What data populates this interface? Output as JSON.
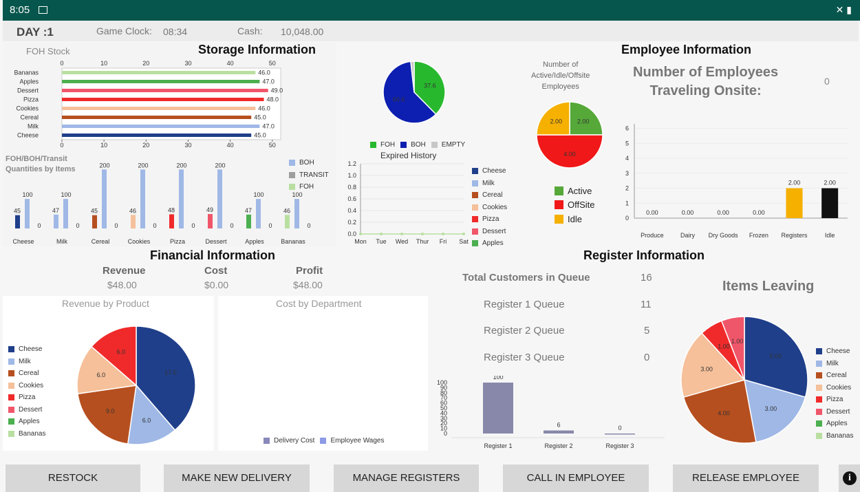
{
  "status": {
    "time": "8:05"
  },
  "header": {
    "day": "DAY :1",
    "game_clock_label": "Game Clock:",
    "game_clock_value": "08:34",
    "cash_label": "Cash:",
    "cash_value": "10,048.00"
  },
  "colors": {
    "status_bar": "#07564d",
    "boh": "#9fb8e6",
    "transit": "#9e9e9e",
    "foh_light": "#b9dfa0"
  },
  "storage": {
    "title": "Storage Information",
    "foh_label": "FOH Stock",
    "qty_label": "FOH/BOH/Transit\nQuantities by Items"
  },
  "expired": {
    "title": "Expired History"
  },
  "employee": {
    "title": "Employee Information",
    "pie_label": "Number of\nActive/Idle/Offsite\nEmployees",
    "traveling_label": "Number of Employees\nTraveling Onsite:",
    "traveling_value": "0"
  },
  "financial": {
    "title": "Financial Information",
    "revenue_label": "Revenue",
    "revenue_value": "$48.00",
    "cost_label": "Cost",
    "cost_value": "$0.00",
    "profit_label": "Profit",
    "profit_value": "$48.00",
    "rev_by_product": "Revenue by Product",
    "cost_by_dept": "Cost by Department"
  },
  "register": {
    "title": "Register Information",
    "total_label": "Total Customers in Queue",
    "total_value": "16",
    "r1_label": "Register 1 Queue",
    "r1_value": "11",
    "r2_label": "Register 2 Queue",
    "r2_value": "5",
    "r3_label": "Register 3 Queue",
    "r3_value": "0",
    "items_leaving": "Items Leaving"
  },
  "buttons": {
    "restock": "RESTOCK",
    "delivery": "MAKE NEW DELIVERY",
    "registers": "MANAGE REGISTERS",
    "call": "CALL IN EMPLOYEE",
    "release": "RELEASE EMPLOYEE"
  },
  "chart_data": [
    {
      "type": "bar",
      "orientation": "horizontal",
      "categories": [
        "Bananas",
        "Apples",
        "Dessert",
        "Pizza",
        "Cookies",
        "Cereal",
        "Milk",
        "Cheese"
      ],
      "values": [
        46.0,
        47.0,
        49.0,
        48.0,
        46.0,
        45.0,
        47.0,
        45.0
      ],
      "colors": [
        "#b9dfa0",
        "#4caf50",
        "#f0566a",
        "#f02a2a",
        "#f5c09a",
        "#b64f1f",
        "#9fb8e6",
        "#1f3f8a"
      ],
      "xticks": [
        0,
        10,
        20,
        30,
        40,
        50
      ],
      "xlim": [
        0,
        52
      ]
    },
    {
      "type": "bar",
      "categories": [
        "Cheese",
        "Milk",
        "Cereal",
        "Cookies",
        "Pizza",
        "Dessert",
        "Apples",
        "Bananas"
      ],
      "series": [
        {
          "name": "FOH",
          "values": [
            45,
            47,
            45,
            46,
            48,
            49,
            47,
            46
          ],
          "colors": [
            "#1f3f8a",
            "#9fb8e6",
            "#b64f1f",
            "#f5c09a",
            "#f02a2a",
            "#f0566a",
            "#4caf50",
            "#b9dfa0"
          ]
        },
        {
          "name": "BOH",
          "values": [
            100,
            100,
            200,
            200,
            200,
            200,
            100,
            100
          ]
        },
        {
          "name": "TRANSIT",
          "values": [
            0,
            0,
            0,
            0,
            0,
            0,
            0,
            0
          ]
        }
      ],
      "ylim": [
        0,
        210
      ]
    },
    {
      "type": "pie",
      "legend": [
        "FOH",
        "BOH",
        "EMPTY"
      ],
      "values": [
        37.6,
        60.6,
        1.8
      ],
      "labels": [
        "37.6",
        "60.6",
        ""
      ],
      "colors": [
        "#28b82e",
        "#0d1fb0",
        "#c7c7c7"
      ]
    },
    {
      "type": "line",
      "title": "Expired History",
      "categories": [
        "Mon",
        "Tue",
        "Wed",
        "Thur",
        "Fri",
        "Sat"
      ],
      "yticks": [
        "0.0",
        "0.2",
        "0.4",
        "0.6",
        "0.8",
        "1.0",
        "1.2"
      ],
      "ylim": [
        0,
        1.2
      ],
      "series": [
        {
          "name": "Apples",
          "values": [
            0,
            0,
            0,
            0,
            0,
            0
          ]
        }
      ],
      "legend": [
        "Cheese",
        "Milk",
        "Cereal",
        "Cookies",
        "Pizza",
        "Dessert",
        "Apples"
      ],
      "colors": [
        "#1f3f8a",
        "#9fb8e6",
        "#b64f1f",
        "#f5c09a",
        "#f02a2a",
        "#f0566a",
        "#4caf50"
      ]
    },
    {
      "type": "pie",
      "legend": [
        "Active",
        "OffSite",
        "Idle"
      ],
      "values": [
        2,
        4,
        2
      ],
      "labels": [
        "2.00",
        "4.00",
        "2.00"
      ],
      "colors": [
        "#56a839",
        "#f01818",
        "#f5b000"
      ]
    },
    {
      "type": "bar",
      "categories": [
        "Produce",
        "Dairy",
        "Dry Goods",
        "Frozen",
        "Registers",
        "Idle"
      ],
      "values": [
        0,
        0,
        0,
        0,
        2,
        2
      ],
      "labels": [
        "0.00",
        "0.00",
        "0.00",
        "0.00",
        "2.00",
        "2.00"
      ],
      "colors": [
        "#ccc",
        "#ccc",
        "#ccc",
        "#ccc",
        "#f5b000",
        "#111"
      ],
      "yticks": [
        0,
        1,
        2,
        3,
        4,
        5,
        6
      ],
      "ylim": [
        0,
        6.3
      ]
    },
    {
      "type": "pie",
      "title": "Revenue by Product",
      "legend": [
        "Cheese",
        "Milk",
        "Cereal",
        "Cookies",
        "Pizza",
        "Dessert",
        "Apples",
        "Bananas"
      ],
      "values": [
        17,
        6,
        9,
        6,
        6,
        0,
        0,
        0
      ],
      "labels": [
        "17.0",
        "6.0",
        "9.0",
        "6.0",
        "6.0",
        "0.0",
        "",
        ""
      ],
      "colors": [
        "#1f3f8a",
        "#9fb8e6",
        "#b64f1f",
        "#f5c09a",
        "#f02a2a",
        "#f0566a",
        "#4caf50",
        "#b9dfa0"
      ]
    },
    {
      "type": "pie",
      "title": "Cost by Department",
      "legend": [
        "Delivery Cost",
        "Employee Wages"
      ],
      "values": [
        0,
        0
      ],
      "colors": [
        "#8888bb",
        "#8d9ae6"
      ]
    },
    {
      "type": "bar",
      "categories": [
        "Register 1",
        "Register 2",
        "Register 3"
      ],
      "values": [
        100,
        6,
        0
      ],
      "labels": [
        "100",
        "6",
        "0"
      ],
      "yticks": [
        0,
        10,
        20,
        30,
        40,
        50,
        60,
        70,
        80,
        90,
        100
      ],
      "ylim": [
        0,
        100
      ],
      "color": "#8888aa"
    },
    {
      "type": "pie",
      "title": "Items Leaving",
      "legend": [
        "Cheese",
        "Milk",
        "Cereal",
        "Cookies",
        "Pizza",
        "Dessert",
        "Apples",
        "Bananas"
      ],
      "values": [
        5,
        3,
        4,
        3,
        1,
        1,
        0,
        0
      ],
      "labels": [
        "5.00",
        "3.00",
        "4.00",
        "3.00",
        "1.00",
        "1.00",
        "",
        ""
      ],
      "colors": [
        "#1f3f8a",
        "#9fb8e6",
        "#b64f1f",
        "#f5c09a",
        "#f02a2a",
        "#f0566a",
        "#4caf50",
        "#b9dfa0"
      ]
    }
  ]
}
